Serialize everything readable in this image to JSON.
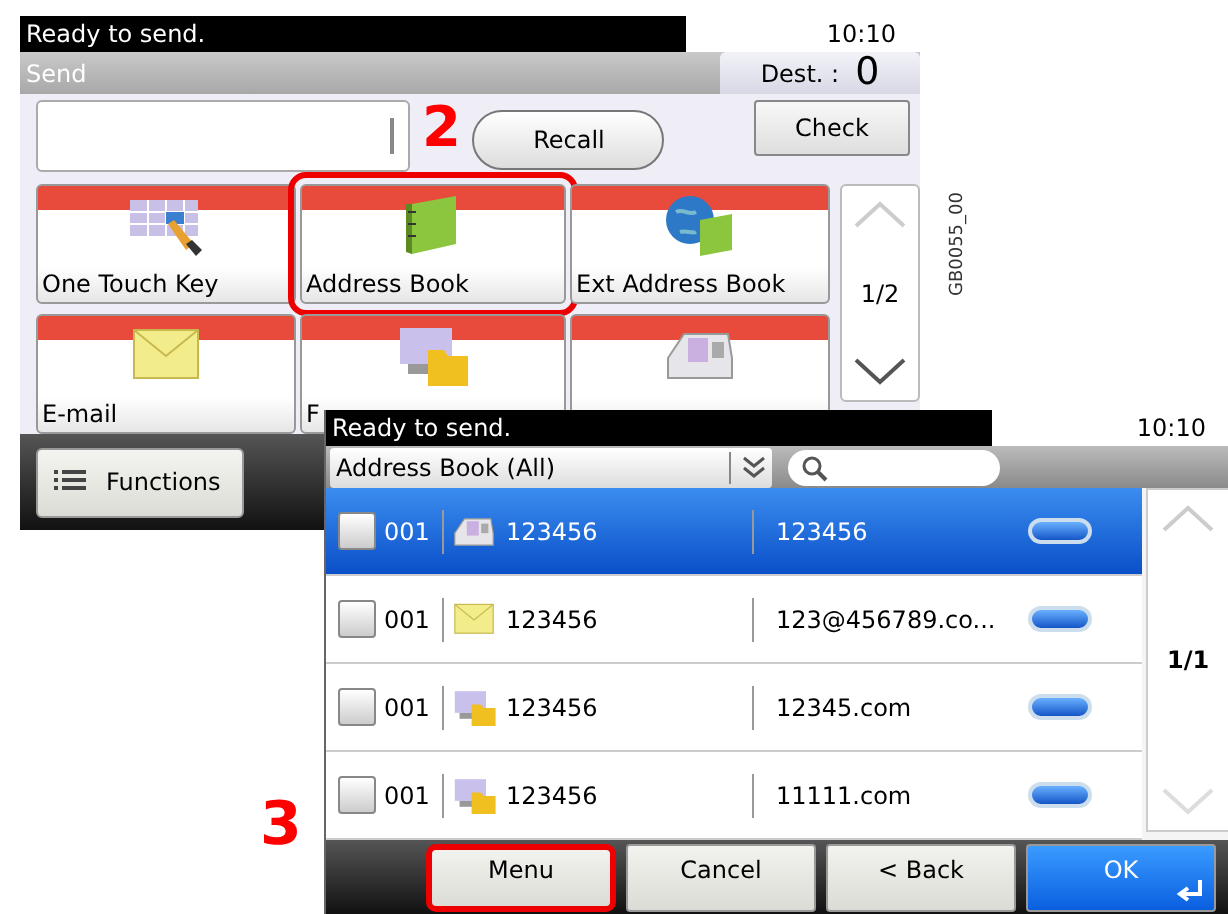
{
  "back_screen": {
    "status": "Ready to send.",
    "time": "10:10",
    "title": "Send",
    "dest_label": "Dest. :",
    "dest_count": "0",
    "recall": "Recall",
    "check": "Check",
    "tiles": [
      {
        "label": "One Touch Key",
        "kind": "onetouch",
        "selected": false
      },
      {
        "label": "Address Book",
        "kind": "book",
        "selected": true
      },
      {
        "label": "Ext Address Book",
        "kind": "extbook",
        "selected": false
      },
      {
        "label": "E-mail",
        "kind": "email",
        "selected": false
      },
      {
        "label": "F",
        "kind": "folder",
        "selected": false
      },
      {
        "kind": "fax",
        "selected": false
      }
    ],
    "page": "1/2",
    "functions": "Functions"
  },
  "step_2": "2",
  "figure_code": "GB0055_00",
  "front_screen": {
    "status": "Ready to send.",
    "time": "10:10",
    "dropdown": "Address Book (All)",
    "rows": [
      {
        "number": "001",
        "kind": "fax",
        "name": "123456",
        "address": "123456",
        "selected": true,
        "checked": false
      },
      {
        "number": "001",
        "kind": "email",
        "name": "123456",
        "address": "123@456789.co...",
        "selected": false,
        "checked": false
      },
      {
        "number": "001",
        "kind": "folder",
        "name": "123456",
        "address": "12345.com",
        "selected": false,
        "checked": false
      },
      {
        "number": "001",
        "kind": "folder",
        "name": "123456",
        "address": "11111.com",
        "selected": false,
        "checked": false
      }
    ],
    "page": "1/1",
    "buttons": [
      {
        "label": "Menu",
        "kind": "plain",
        "highlighted": true
      },
      {
        "label": "Cancel",
        "kind": "plain",
        "highlighted": false
      },
      {
        "label": "< Back",
        "kind": "plain",
        "highlighted": false
      },
      {
        "label": "OK",
        "kind": "primary",
        "highlighted": false
      }
    ]
  },
  "step_3": "3"
}
